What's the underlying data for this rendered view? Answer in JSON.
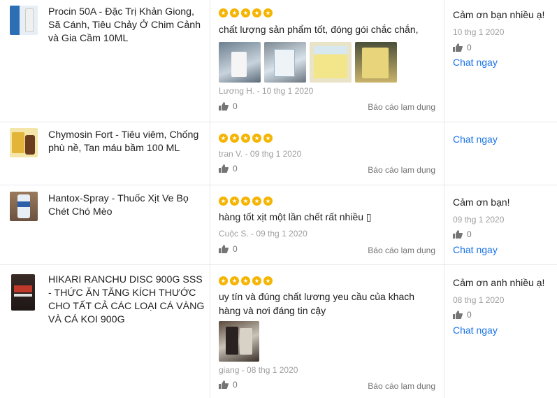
{
  "reviews": [
    {
      "product": "Procin 50A - Đặc Trị Khản Giong, Sã Cánh, Tiêu Chảy Ở Chim Cảnh và Gia Cầm 10ML",
      "rating": 5,
      "text": "chất lượng sản phẩm tốt, đóng gói chắc chắn,",
      "images": [
        "review-photo-1",
        "review-photo-2",
        "review-photo-3",
        "review-photo-4"
      ],
      "author_date": "Lương H. - 10 thg 1 2020",
      "likes": "0",
      "report": "Báo cáo lạm dụng",
      "seller_reply": "Cảm ơn bạn nhiều ạ!",
      "seller_date": "10 thg 1 2020",
      "seller_likes": "0",
      "chat": "Chat ngay"
    },
    {
      "product": "Chymosin Fort - Tiêu viêm, Chống phù nề, Tan máu bầm 100 ML",
      "rating": 5,
      "text": "",
      "images": [],
      "author_date": "tran V. - 09 thg 1 2020",
      "likes": "0",
      "report": "Báo cáo lạm dụng",
      "seller_reply": "",
      "seller_date": "",
      "seller_likes": "",
      "chat": "Chat ngay"
    },
    {
      "product": "Hantox-Spray - Thuốc Xịt Ve Bọ Chét Chó Mèo",
      "rating": 5,
      "text": "hàng tốt xịt một lần chết rất nhiều ▯",
      "images": [],
      "author_date": "Cuộc S. - 09 thg 1 2020",
      "likes": "0",
      "report": "Báo cáo lạm dụng",
      "seller_reply": "Cảm ơn bạn!",
      "seller_date": "09 thg 1 2020",
      "seller_likes": "0",
      "chat": "Chat ngay"
    },
    {
      "product": "HIKARI RANCHU DISC 900G SSS - THỨC ĂN TĂNG KÍCH THƯỚC CHO TẤT CẢ CÁC LOẠI CÁ VÀNG VÀ CÁ KOI 900G",
      "rating": 5,
      "text": "uy tín và đúng chất lương yeu cầu của khach hàng và nơi đáng tin cậy",
      "images": [
        "review-photo-1"
      ],
      "author_date": "giang - 08 thg 1 2020",
      "likes": "0",
      "report": "Báo cáo lạm dụng",
      "seller_reply": "Cảm ơn anh nhiều ạ!",
      "seller_date": "08 thg 1 2020",
      "seller_likes": "0",
      "chat": "Chat ngay"
    }
  ],
  "colors": {
    "star": "#f5b400",
    "link": "#1a73e8",
    "divider": "#e8e8e8",
    "muted": "#9e9e9e"
  }
}
